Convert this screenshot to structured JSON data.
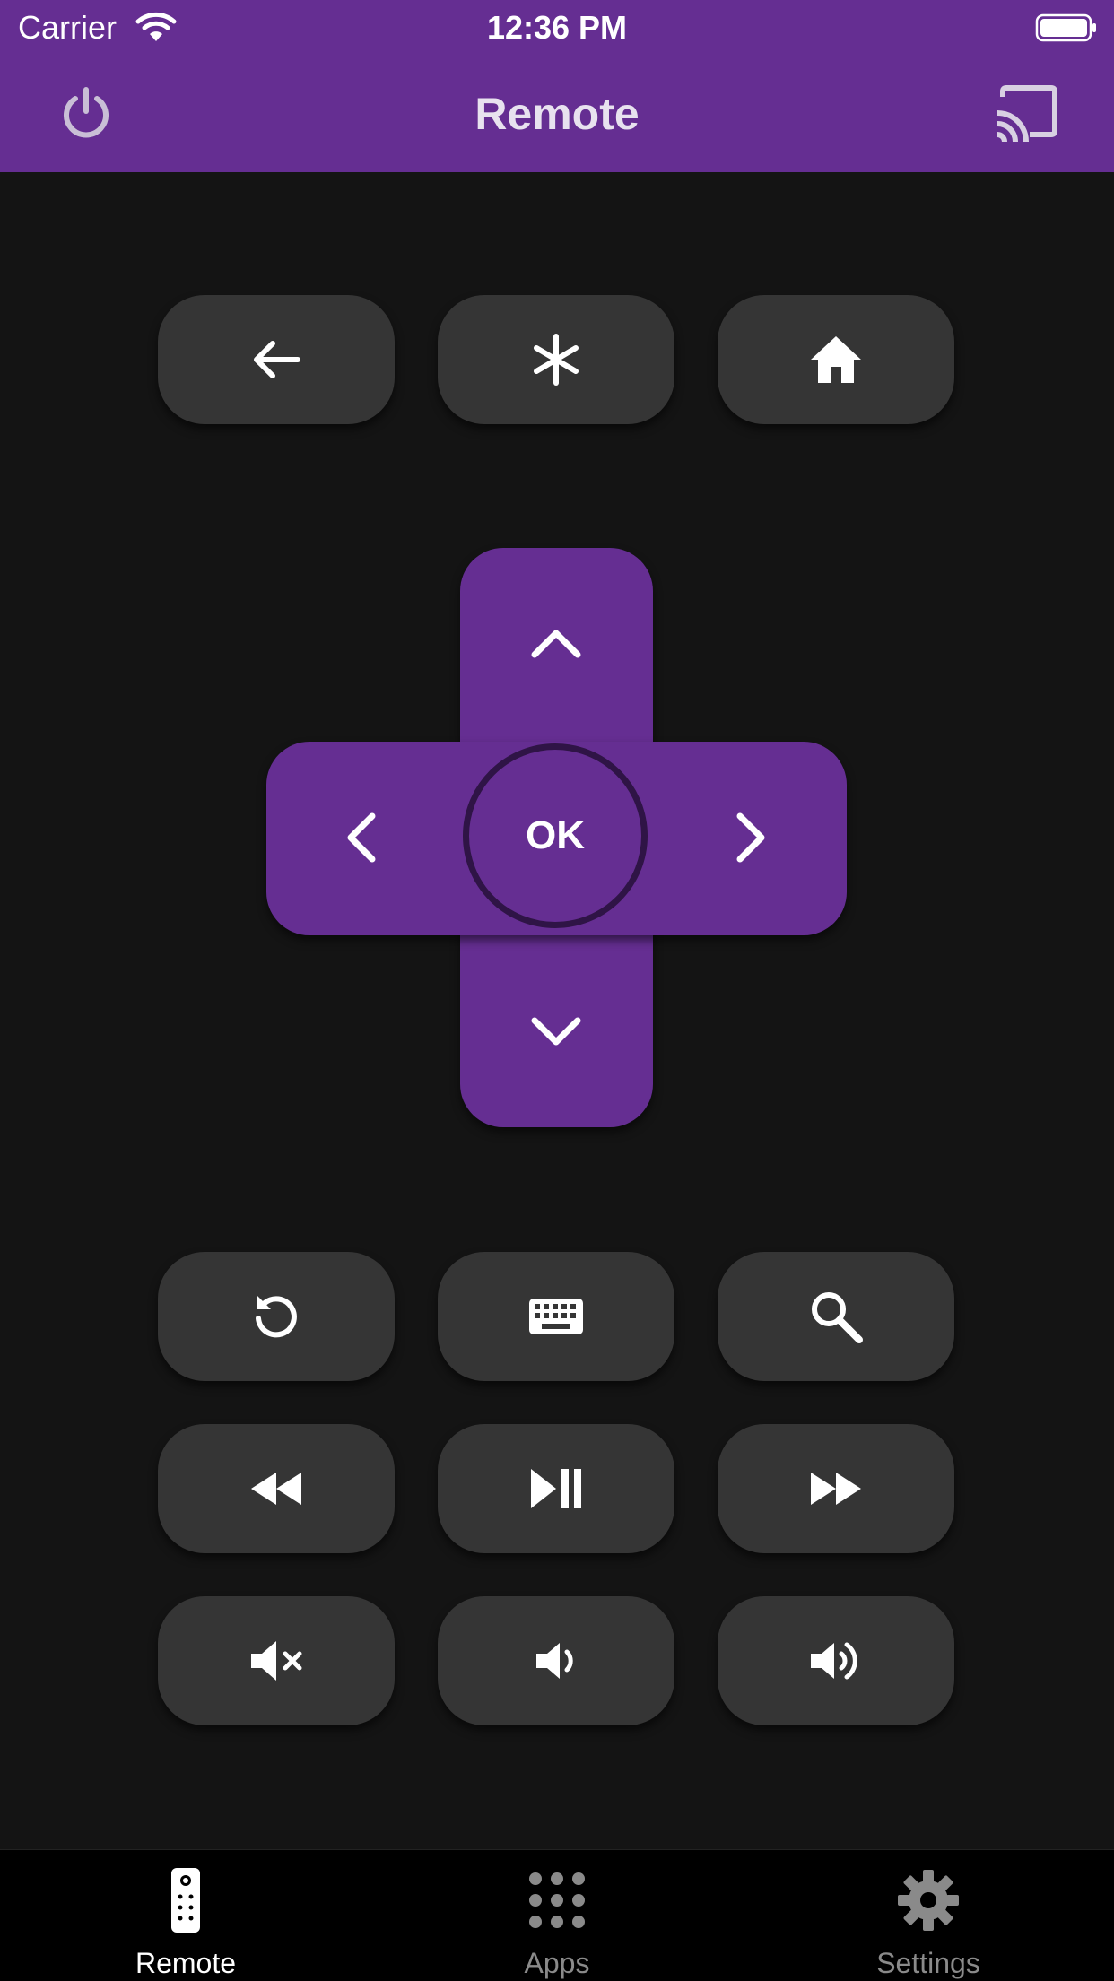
{
  "status_bar": {
    "carrier": "Carrier",
    "time": "12:36 PM"
  },
  "nav": {
    "title": "Remote",
    "left_icon": "power-icon",
    "right_icon": "cast-icon"
  },
  "dpad": {
    "ok_label": "OK"
  },
  "tabs": [
    {
      "label": "Remote",
      "icon": "remote-icon",
      "active": true
    },
    {
      "label": "Apps",
      "icon": "apps-grid-icon",
      "active": false
    },
    {
      "label": "Settings",
      "icon": "gear-icon",
      "active": false
    }
  ],
  "colors": {
    "accent": "#652e92",
    "background": "#141414",
    "button": "#353535"
  }
}
